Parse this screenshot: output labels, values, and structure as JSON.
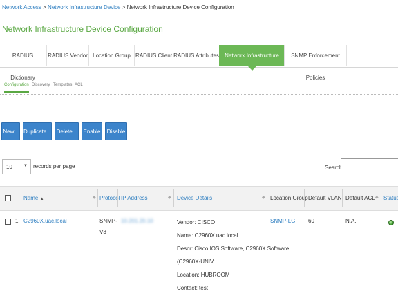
{
  "breadcrumb": {
    "items": [
      "Network Access",
      "Network Infrastructure Device"
    ],
    "current": "Network Infrastructure Device Configuration",
    "separator": ">"
  },
  "page_title": "Network Infrastructure Device Configuration",
  "tabs": [
    {
      "label": "RADIUS Dictionary"
    },
    {
      "label": "RADIUS Vendor"
    },
    {
      "label": "Location Group"
    },
    {
      "label": "RADIUS Client"
    },
    {
      "label": "RADIUS Attributes"
    },
    {
      "label": "Network Infrastructure Device"
    },
    {
      "label": "SNMP Enforcement Policies"
    }
  ],
  "active_tab": "Network Infrastructure Device",
  "subtabs": [
    "Configuration",
    "Discovery",
    "Templates",
    "ACL"
  ],
  "active_subtab": "Configuration",
  "buttons": {
    "new": "New...",
    "duplicate": "Duplicate...",
    "delete": "Delete...",
    "enable": "Enable",
    "disable": "Disable"
  },
  "pagination": {
    "page_size": "10",
    "records_label": "records per page"
  },
  "search": {
    "label": "Search:",
    "value": ""
  },
  "table": {
    "headers": {
      "name": "Name",
      "protocol": "Protocol",
      "ip": "IP Address",
      "details": "Device Details",
      "location": "Location Group",
      "vlan": "Default VLAN",
      "acl": "Default ACL",
      "status": "Status"
    },
    "rows": [
      {
        "index": "1",
        "name": "C2960X.uac.local",
        "protocol_line1": "SNMP-",
        "protocol_line2": "V3",
        "ip": "10.201.20.10",
        "details": [
          "Vendor: CISCO",
          "Name: C2960X.uac.local",
          "Descr: Cisco IOS Software, C2960X Software",
          "(C2960X-UNIV...",
          "Location: HUBROOM",
          "Contact: test"
        ],
        "location": "SNMP-LG",
        "vlan": "60",
        "acl": "N.A.",
        "status": "enabled"
      }
    ]
  },
  "colors": {
    "accent_green": "#6cb856",
    "button_blue": "#3c84cb",
    "link_blue": "#2f7fc1"
  }
}
